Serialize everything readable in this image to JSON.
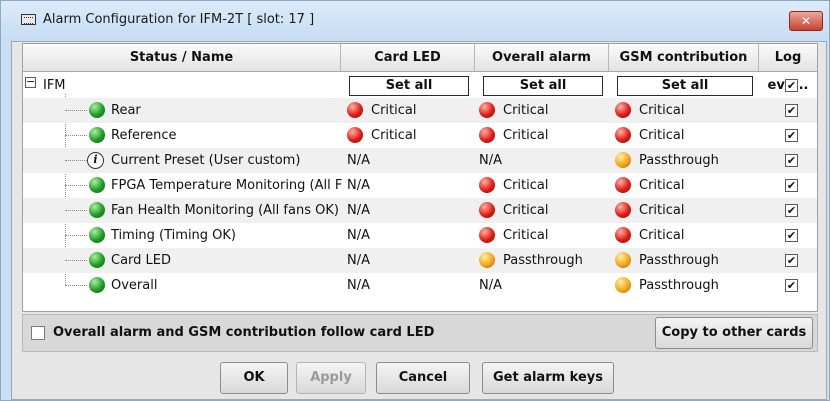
{
  "window": {
    "title": "Alarm Configuration for IFM-2T [ slot: 17 ]",
    "close_label": "✕"
  },
  "table": {
    "headers": [
      "Status / Name",
      "Card LED",
      "Overall alarm",
      "GSM contribution",
      "Log eve..."
    ],
    "group": {
      "name": "IFM",
      "set_all": [
        "Set all",
        "Set all",
        "Set all"
      ],
      "log_checked": "✔"
    },
    "rows": [
      {
        "icon": "green",
        "name": "Rear",
        "card_led": {
          "color": "red",
          "text": "Critical"
        },
        "overall": {
          "color": "red",
          "text": "Critical"
        },
        "gsm": {
          "color": "red",
          "text": "Critical"
        },
        "log": "✔"
      },
      {
        "icon": "green",
        "name": "Reference",
        "card_led": {
          "color": "red",
          "text": "Critical"
        },
        "overall": {
          "color": "red",
          "text": "Critical"
        },
        "gsm": {
          "color": "red",
          "text": "Critical"
        },
        "log": "✔"
      },
      {
        "icon": "info",
        "name": "Current Preset (User custom)",
        "card_led": {
          "color": "",
          "text": "N/A"
        },
        "overall": {
          "color": "",
          "text": "N/A"
        },
        "gsm": {
          "color": "orange",
          "text": "Passthrough"
        },
        "log": "✔"
      },
      {
        "icon": "green",
        "name": "FPGA Temperature Monitoring (All F",
        "card_led": {
          "color": "",
          "text": "N/A"
        },
        "overall": {
          "color": "red",
          "text": "Critical"
        },
        "gsm": {
          "color": "red",
          "text": "Critical"
        },
        "log": "✔"
      },
      {
        "icon": "green",
        "name": "Fan Health Monitoring (All fans OK)",
        "card_led": {
          "color": "",
          "text": "N/A"
        },
        "overall": {
          "color": "red",
          "text": "Critical"
        },
        "gsm": {
          "color": "red",
          "text": "Critical"
        },
        "log": "✔"
      },
      {
        "icon": "green",
        "name": "Timing (Timing OK)",
        "card_led": {
          "color": "",
          "text": "N/A"
        },
        "overall": {
          "color": "red",
          "text": "Critical"
        },
        "gsm": {
          "color": "red",
          "text": "Critical"
        },
        "log": "✔"
      },
      {
        "icon": "green",
        "name": "Card LED",
        "card_led": {
          "color": "",
          "text": "N/A"
        },
        "overall": {
          "color": "orange",
          "text": "Passthrough"
        },
        "gsm": {
          "color": "orange",
          "text": "Passthrough"
        },
        "log": "✔"
      },
      {
        "icon": "green",
        "name": "Overall",
        "card_led": {
          "color": "",
          "text": "N/A"
        },
        "overall": {
          "color": "",
          "text": "N/A"
        },
        "gsm": {
          "color": "orange",
          "text": "Passthrough"
        },
        "log": "✔"
      }
    ]
  },
  "footer": {
    "follow_label": "Overall alarm and GSM contribution follow card LED",
    "copy_button": "Copy to other cards"
  },
  "buttons": {
    "ok": "OK",
    "apply": "Apply",
    "cancel": "Cancel",
    "get_keys": "Get alarm keys"
  },
  "colors": {
    "titlebar": "#c9dff4",
    "critical": "#e01d14",
    "passthrough": "#f3a61a",
    "ok": "#1e9c24"
  }
}
